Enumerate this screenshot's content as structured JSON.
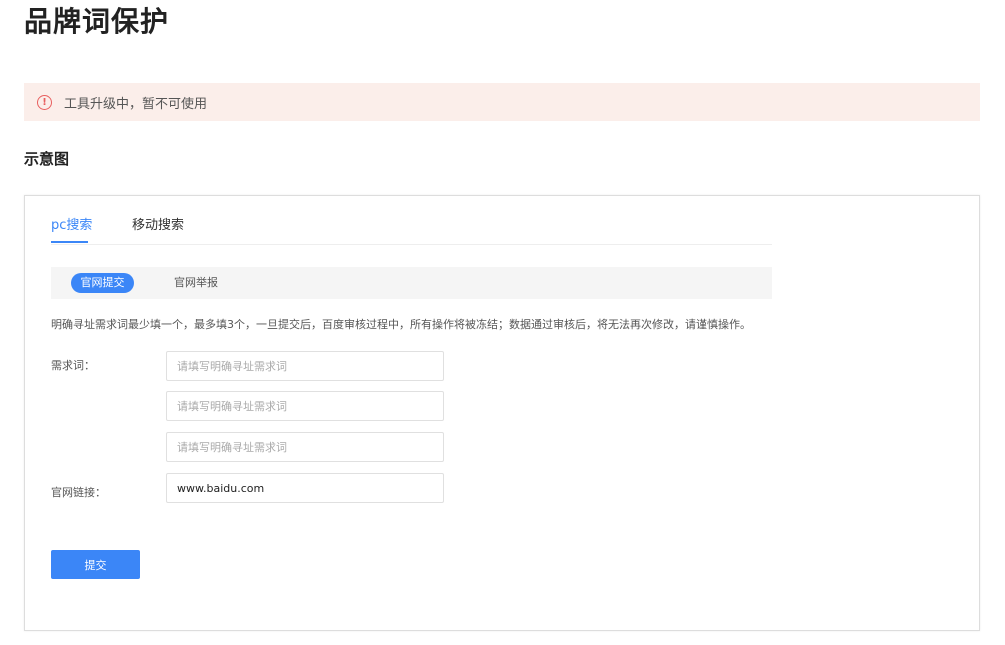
{
  "page": {
    "title": "品牌词保护"
  },
  "alert": {
    "icon": "exclamation-circle-icon",
    "icon_glyph": "!",
    "text": "工具升级中，暂不可使用",
    "color": "#e85f5f",
    "background": "#fbeeea"
  },
  "section": {
    "title": "示意图"
  },
  "demo": {
    "tabs": [
      {
        "label": "pc搜索",
        "active": true
      },
      {
        "label": "移动搜索",
        "active": false
      }
    ],
    "subtabs": [
      {
        "label": "官网提交",
        "active": true
      },
      {
        "label": "官网举报",
        "active": false
      }
    ],
    "hint": "明确寻址需求词最少填一个，最多填3个，一旦提交后，百度审核过程中，所有操作将被冻结；数据通过审核后，将无法再次修改，请谨慎操作。",
    "form": {
      "keywords_label": "需求词：",
      "keywords": [
        {
          "value": "",
          "placeholder": "请填写明确寻址需求词"
        },
        {
          "value": "",
          "placeholder": "请填写明确寻址需求词"
        },
        {
          "value": "",
          "placeholder": "请填写明确寻址需求词"
        }
      ],
      "url_label": "官网链接：",
      "url_value": "www.baidu.com",
      "submit_label": "提交"
    },
    "accent_color": "#3b86f7"
  }
}
